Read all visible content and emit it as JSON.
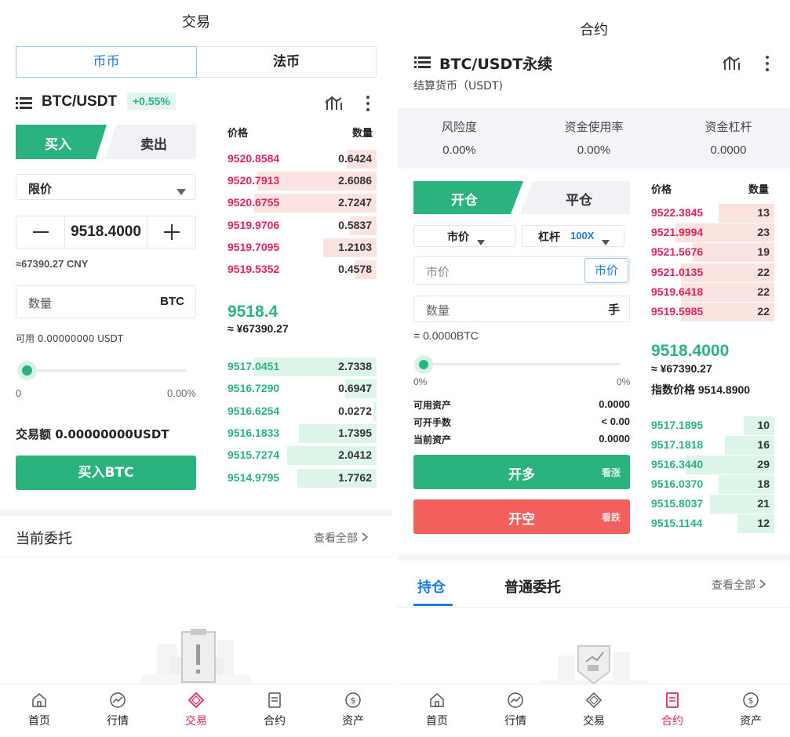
{
  "left": {
    "header_title": "交易",
    "segments": [
      "币币",
      "法币"
    ],
    "pair": "BTC/USDT",
    "change": "+0.55%",
    "buy_tab": "买入",
    "sell_tab": "卖出",
    "order_type": "限价",
    "price_value": "9518.4000",
    "cny_hint": "≈67390.27 CNY",
    "qty_placeholder": "数量",
    "qty_unit": "BTC",
    "available": "可用 0.00000000 USDT",
    "slider_min": "0",
    "slider_pct": "0.00%",
    "trade_amount": "交易额 0.00000000USDT",
    "buy_button": "买入BTC",
    "book_price_header": "价格",
    "book_qty_header": "数量",
    "asks": [
      {
        "price": "9520.8584",
        "qty": "0.6424",
        "depth": 0.2
      },
      {
        "price": "9520.7913",
        "qty": "2.6086",
        "depth": 0.8
      },
      {
        "price": "9520.6755",
        "qty": "2.7247",
        "depth": 0.82
      },
      {
        "price": "9519.9706",
        "qty": "0.5837",
        "depth": 0.18
      },
      {
        "price": "9519.7095",
        "qty": "1.2103",
        "depth": 0.36
      },
      {
        "price": "9519.5352",
        "qty": "0.4578",
        "depth": 0.14
      }
    ],
    "last_price": "9518.4",
    "last_cny": "≈ ¥67390.27",
    "bids": [
      {
        "price": "9517.0451",
        "qty": "2.7338",
        "depth": 0.82
      },
      {
        "price": "9516.7290",
        "qty": "0.6947",
        "depth": 0.21
      },
      {
        "price": "9516.6254",
        "qty": "0.0272",
        "depth": 0.02
      },
      {
        "price": "9516.1833",
        "qty": "1.7395",
        "depth": 0.52
      },
      {
        "price": "9515.7274",
        "qty": "2.0412",
        "depth": 0.6
      },
      {
        "price": "9514.9795",
        "qty": "1.7762",
        "depth": 0.53
      }
    ],
    "orders_title": "当前委托",
    "view_all": "查看全部"
  },
  "right": {
    "header_title": "合约",
    "pair": "BTC/USDT永续",
    "settle": "结算货币（USDT)",
    "stats": [
      {
        "label": "风险度",
        "value": "0.00%"
      },
      {
        "label": "资金使用率",
        "value": "0.00%"
      },
      {
        "label": "资金杠杆",
        "value": "0.0000"
      }
    ],
    "open_tab": "开仓",
    "close_tab": "平仓",
    "order_type": "市价",
    "leverage_label": "杠杆",
    "leverage_value": "100X",
    "price_placeholder": "市价",
    "market_button": "市价",
    "qty_placeholder": "数量",
    "qty_unit": "手",
    "qty_equiv": "= 0.0000BTC",
    "slider_min": "0%",
    "slider_max": "0%",
    "assets": [
      {
        "label": "可用资产",
        "value": "0.0000"
      },
      {
        "label": "可开手数",
        "value": "< 0.00"
      },
      {
        "label": "当前资产",
        "value": "0.0000"
      }
    ],
    "long_button": "开多",
    "long_sub": "看涨",
    "short_button": "开空",
    "short_sub": "看跌",
    "book_price_header": "价格",
    "book_qty_header": "数量",
    "asks": [
      {
        "price": "9522.3845",
        "qty": "13",
        "depth": 0.45
      },
      {
        "price": "9521.9994",
        "qty": "23",
        "depth": 0.8
      },
      {
        "price": "9521.5676",
        "qty": "19",
        "depth": 0.66
      },
      {
        "price": "9521.0135",
        "qty": "22",
        "depth": 0.76
      },
      {
        "price": "9519.6418",
        "qty": "22",
        "depth": 0.76
      },
      {
        "price": "9519.5985",
        "qty": "22",
        "depth": 0.76
      }
    ],
    "last_price": "9518.4000",
    "last_cny": "≈ ¥67390.27",
    "index_price": "指数价格 9514.8900",
    "bids": [
      {
        "price": "9517.1895",
        "qty": "10",
        "depth": 0.25
      },
      {
        "price": "9517.1818",
        "qty": "16",
        "depth": 0.4
      },
      {
        "price": "9516.3440",
        "qty": "29",
        "depth": 0.72
      },
      {
        "price": "9516.0370",
        "qty": "18",
        "depth": 0.45
      },
      {
        "price": "9515.8037",
        "qty": "21",
        "depth": 0.52
      },
      {
        "price": "9515.1144",
        "qty": "12",
        "depth": 0.3
      }
    ],
    "position_tab": "持仓",
    "normal_orders_tab": "普通委托",
    "view_all": "查看全部"
  },
  "tabbar": [
    "首页",
    "行情",
    "交易",
    "合约",
    "资产"
  ],
  "colors": {
    "green": "#2ab37f",
    "red": "#e0245e",
    "short_red": "#f25f5c",
    "blue": "#1e7be0"
  }
}
